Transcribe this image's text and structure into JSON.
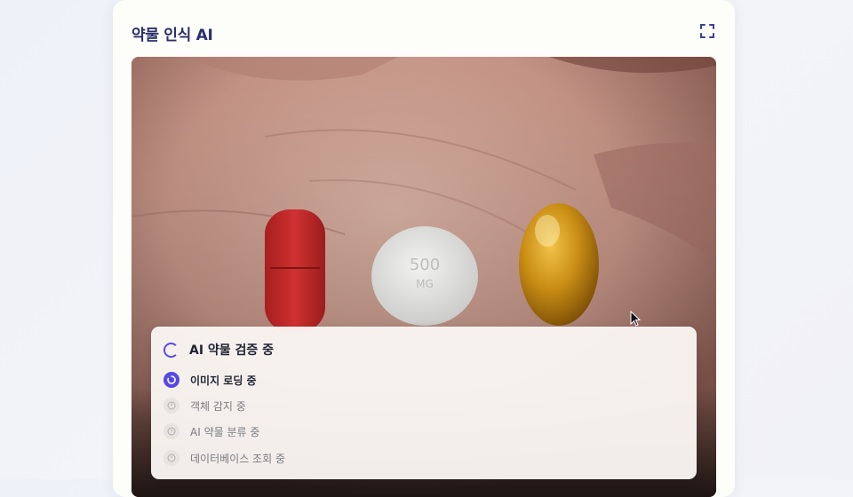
{
  "card": {
    "title": "약물 인식 AI",
    "expand_icon": "expand-icon"
  },
  "image": {
    "pill_imprint_line1": "500",
    "pill_imprint_line2": "MG"
  },
  "status_panel": {
    "title": "AI 약물 검증 중",
    "spinner_icon": "spinner-icon",
    "steps": [
      {
        "label": "이미지 로딩 중",
        "state": "active"
      },
      {
        "label": "객체 감지 중",
        "state": "pending"
      },
      {
        "label": "AI 약물 분류 중",
        "state": "pending"
      },
      {
        "label": "데이터베이스 조회 중",
        "state": "pending"
      }
    ]
  },
  "colors": {
    "accent": "#5548e6",
    "title": "#2a2f6a",
    "card_bg": "#fdfdf9"
  }
}
